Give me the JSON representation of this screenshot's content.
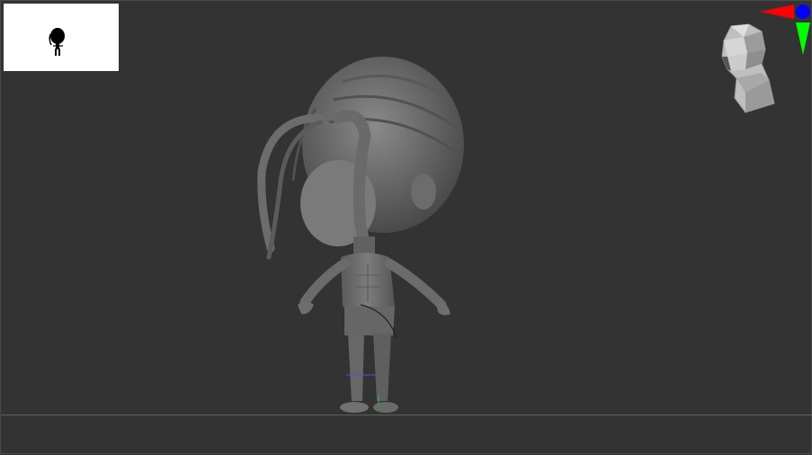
{
  "app": {
    "viewport_name": "",
    "background_color": "#333333",
    "floor_color": "#4f6a4f"
  },
  "thumbnail": {
    "icon": "character-silhouette-icon",
    "background": "#ffffff",
    "silhouette_color": "#000000"
  },
  "model": {
    "icon": "chibi-character-sculpt",
    "color": "#6e6e6e"
  },
  "navigator": {
    "icon": "head-orientation-icon"
  },
  "axis_gizmo": {
    "icon": "axis-gizmo-icon",
    "x_color": "#ff0000",
    "y_color": "#00ff00",
    "z_color": "#0000ff"
  }
}
